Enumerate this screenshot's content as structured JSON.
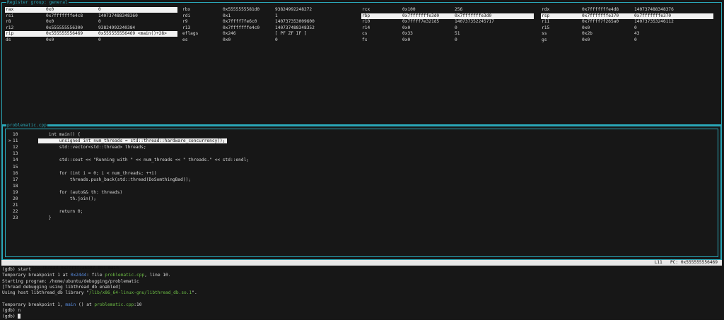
{
  "reg_pane": {
    "title": "Register group: general",
    "rows": [
      [
        {
          "name": "rax",
          "hex": "0x0",
          "dec": "0",
          "hl": true
        },
        {
          "name": "rbx",
          "hex": "0x5555555581d0",
          "dec": "93824992248272",
          "hl": false
        },
        {
          "name": "rcx",
          "hex": "0x100",
          "dec": "256",
          "hl": false
        },
        {
          "name": "rdx",
          "hex": "0x7fffffffe4d8",
          "dec": "140737488348376",
          "hl": false
        }
      ],
      [
        {
          "name": "rsi",
          "hex": "0x7fffffffe4c8",
          "dec": "140737488348360",
          "hl": false
        },
        {
          "name": "rdi",
          "hex": "0x1",
          "dec": "1",
          "hl": false
        },
        {
          "name": "rbp",
          "hex": "0x7fffffffe3d0",
          "dec": "0x7fffffffe3d0",
          "hl": true
        },
        {
          "name": "rsp",
          "hex": "0x7fffffffe370",
          "dec": "0x7fffffffe370",
          "hl": true
        }
      ],
      [
        {
          "name": "r8",
          "hex": "0x0",
          "dec": "0",
          "hl": false
        },
        {
          "name": "r9",
          "hex": "0x7ffff7fe6c0",
          "dec": "140737353009600",
          "hl": false
        },
        {
          "name": "r10",
          "hex": "0x7ffff7e321d5",
          "dec": "140737352245717",
          "hl": false
        },
        {
          "name": "r11",
          "hex": "0x7ffff7f265a0",
          "dec": "140737353246112",
          "hl": false
        }
      ],
      [
        {
          "name": "r12",
          "hex": "0x555555556300",
          "dec": "93824992240384",
          "hl": false
        },
        {
          "name": "r13",
          "hex": "0x7fffffffe4c0",
          "dec": "140737488348352",
          "hl": false
        },
        {
          "name": "r14",
          "hex": "0x0",
          "dec": "0",
          "hl": false
        },
        {
          "name": "r15",
          "hex": "0x0",
          "dec": "0",
          "hl": false
        }
      ],
      [
        {
          "name": "rip",
          "hex": "0x555555556469",
          "dec": "0x555555556469 <main()+28>",
          "hl": true
        },
        {
          "name": "eflags",
          "hex": "0x246",
          "dec": "[ PF ZF IF ]",
          "hl": false
        },
        {
          "name": "cs",
          "hex": "0x33",
          "dec": "51",
          "hl": false
        },
        {
          "name": "ss",
          "hex": "0x2b",
          "dec": "43",
          "hl": false
        }
      ],
      [
        {
          "name": "ds",
          "hex": "0x0",
          "dec": "0",
          "hl": false
        },
        {
          "name": "es",
          "hex": "0x0",
          "dec": "0",
          "hl": false
        },
        {
          "name": "fs",
          "hex": "0x0",
          "dec": "0",
          "hl": false
        },
        {
          "name": "gs",
          "hex": "0x0",
          "dec": "0",
          "hl": false
        }
      ]
    ]
  },
  "src_pane": {
    "title": "problematic.cpp",
    "current_marker": ">",
    "lines": [
      {
        "n": "10",
        "code": "    int main() {",
        "cur": false
      },
      {
        "n": "11",
        "code": "        unsigned int num_threads = std::thread::hardware_concurrency();",
        "cur": true
      },
      {
        "n": "12",
        "code": "        std::vector<std::thread> threads;",
        "cur": false
      },
      {
        "n": "13",
        "code": "",
        "cur": false
      },
      {
        "n": "14",
        "code": "        std::cout << \"Running with \" << num_threads << \" threads.\" << std::endl;",
        "cur": false
      },
      {
        "n": "15",
        "code": "",
        "cur": false
      },
      {
        "n": "16",
        "code": "        for (int i = 0; i < num_threads; ++i)",
        "cur": false
      },
      {
        "n": "17",
        "code": "            threads.push_back(std::thread(DoSomthingBad));",
        "cur": false
      },
      {
        "n": "18",
        "code": "",
        "cur": false
      },
      {
        "n": "19",
        "code": "        for (auto&& th: threads)",
        "cur": false
      },
      {
        "n": "20",
        "code": "            th.join();",
        "cur": false
      },
      {
        "n": "21",
        "code": "",
        "cur": false
      },
      {
        "n": "22",
        "code": "        return 0;",
        "cur": false
      },
      {
        "n": "23",
        "code": "    }",
        "cur": false
      }
    ]
  },
  "status_bar": {
    "left": "multi-thre Thread 0x7ffff7a6b07 In: main",
    "line": "L11",
    "pc": "PC: 0x555555556469"
  },
  "console": {
    "lines": [
      [
        {
          "t": "(gdb) start"
        }
      ],
      [
        {
          "t": "Temporary breakpoint 1 at "
        },
        {
          "t": "0x2444",
          "c": "blue"
        },
        {
          "t": ": file "
        },
        {
          "t": "problematic.cpp",
          "c": "green"
        },
        {
          "t": ", line 10."
        }
      ],
      [
        {
          "t": "Starting program: /home/ubuntu/debugging/problematic"
        }
      ],
      [
        {
          "t": "[Thread debugging using libthread_db enabled]"
        }
      ],
      [
        {
          "t": "Using host libthread_db library \""
        },
        {
          "t": "/lib/x86_64-linux-gnu/libthread_db.so.1",
          "c": "green"
        },
        {
          "t": "\"."
        }
      ],
      [
        {
          "t": ""
        }
      ],
      [
        {
          "t": "Temporary breakpoint 1, "
        },
        {
          "t": "main",
          "c": "blue"
        },
        {
          "t": " () at "
        },
        {
          "t": "problematic.cpp",
          "c": "green"
        },
        {
          "t": ":10"
        }
      ],
      [
        {
          "t": "(gdb) n"
        }
      ],
      [
        {
          "t": "(gdb) "
        }
      ]
    ]
  }
}
